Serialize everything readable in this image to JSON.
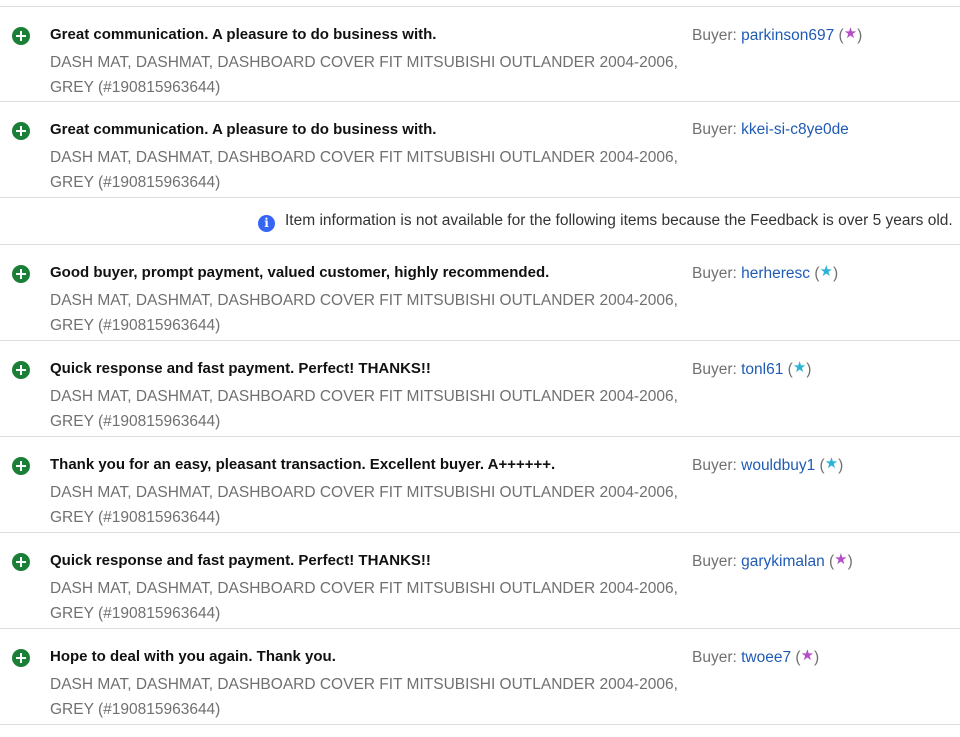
{
  "rows_before": [
    {
      "comment": "Great communication. A pleasure to do business with.",
      "item": "DASH MAT, DASHMAT, DASHBOARD COVER FIT MITSUBISHI OUTLANDER 2004-2006, GREY (#190815963644)",
      "buyer_label": "Buyer:",
      "buyer": "parkinson697",
      "star_color": "#b44ec6",
      "star_open": "(",
      "star": "★",
      "star_close": ")"
    },
    {
      "comment": "Great communication. A pleasure to do business with.",
      "item": "DASH MAT, DASHMAT, DASHBOARD COVER FIT MITSUBISHI OUTLANDER 2004-2006, GREY (#190815963644)",
      "buyer_label": "Buyer:",
      "buyer": "kkei-si-c8ye0de"
    }
  ],
  "info": {
    "icon": "info-icon",
    "text": "Item information is not available for the following items because the Feedback is over 5 years old."
  },
  "rows_after": [
    {
      "comment": "Good buyer, prompt payment, valued customer, highly recommended.",
      "item": "DASH MAT, DASHMAT, DASHBOARD COVER FIT MITSUBISHI OUTLANDER 2004-2006, GREY (#190815963644)",
      "buyer_label": "Buyer:",
      "buyer": "herheresc",
      "star_color": "#2ab3d6",
      "star_open": "(",
      "star": "★",
      "star_close": ")"
    },
    {
      "comment": "Quick response and fast payment. Perfect! THANKS!!",
      "item": "DASH MAT, DASHMAT, DASHBOARD COVER FIT MITSUBISHI OUTLANDER 2004-2006, GREY (#190815963644)",
      "buyer_label": "Buyer:",
      "buyer": "tonl61",
      "star_color": "#2ab3d6",
      "star_open": "(",
      "star": "★",
      "star_close": ")"
    },
    {
      "comment": "Thank you for an easy, pleasant transaction. Excellent buyer. A++++++.",
      "item": "DASH MAT, DASHMAT, DASHBOARD COVER FIT MITSUBISHI OUTLANDER 2004-2006, GREY (#190815963644)",
      "buyer_label": "Buyer:",
      "buyer": "wouldbuy1",
      "star_color": "#2ab3d6",
      "star_open": "(",
      "star": "★",
      "star_close": ")"
    },
    {
      "comment": "Quick response and fast payment. Perfect! THANKS!!",
      "item": "DASH MAT, DASHMAT, DASHBOARD COVER FIT MITSUBISHI OUTLANDER 2004-2006, GREY (#190815963644)",
      "buyer_label": "Buyer:",
      "buyer": "garykimalan",
      "star_color": "#b44ec6",
      "star_open": "(",
      "star": "★",
      "star_close": ")"
    },
    {
      "comment": "Hope to deal with you again. Thank you.",
      "item": "DASH MAT, DASHMAT, DASHBOARD COVER FIT MITSUBISHI OUTLANDER 2004-2006, GREY (#190815963644)",
      "buyer_label": "Buyer:",
      "buyer": "twoee7",
      "star_color": "#b44ec6",
      "star_open": "(",
      "star": "★",
      "star_close": ")"
    }
  ],
  "positive_icon": "plus-circle-icon"
}
